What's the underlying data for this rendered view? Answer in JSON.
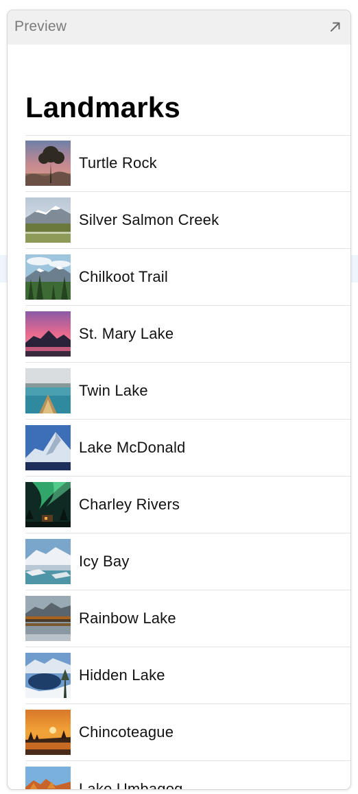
{
  "panel": {
    "header_title": "Preview",
    "open_icon": "arrow-up-right-icon"
  },
  "navigation": {
    "title": "Landmarks"
  },
  "landmarks": [
    {
      "name": "Turtle Rock",
      "image": "joshua-tree-sunset-thumbnail"
    },
    {
      "name": "Silver Salmon Creek",
      "image": "snowy-mountain-meadow-thumbnail"
    },
    {
      "name": "Chilkoot Trail",
      "image": "forest-mountains-thumbnail"
    },
    {
      "name": "St. Mary Lake",
      "image": "pink-sunset-lake-thumbnail"
    },
    {
      "name": "Twin Lake",
      "image": "canoe-on-lake-thumbnail"
    },
    {
      "name": "Lake McDonald",
      "image": "snow-peak-blue-thumbnail"
    },
    {
      "name": "Charley Rivers",
      "image": "northern-lights-cabin-thumbnail"
    },
    {
      "name": "Icy Bay",
      "image": "glacier-bay-thumbnail"
    },
    {
      "name": "Rainbow Lake",
      "image": "mountain-reflection-thumbnail"
    },
    {
      "name": "Hidden Lake",
      "image": "winter-lake-thumbnail"
    },
    {
      "name": "Chincoteague",
      "image": "orange-sunset-marsh-thumbnail"
    },
    {
      "name": "Lake Umbagog",
      "image": "autumn-lake-thumbnail"
    }
  ],
  "colors": {
    "header_background": "#f0f0f0",
    "header_text": "#7a7a7a",
    "separator": "#e2e2e2",
    "row_text": "#111111"
  }
}
